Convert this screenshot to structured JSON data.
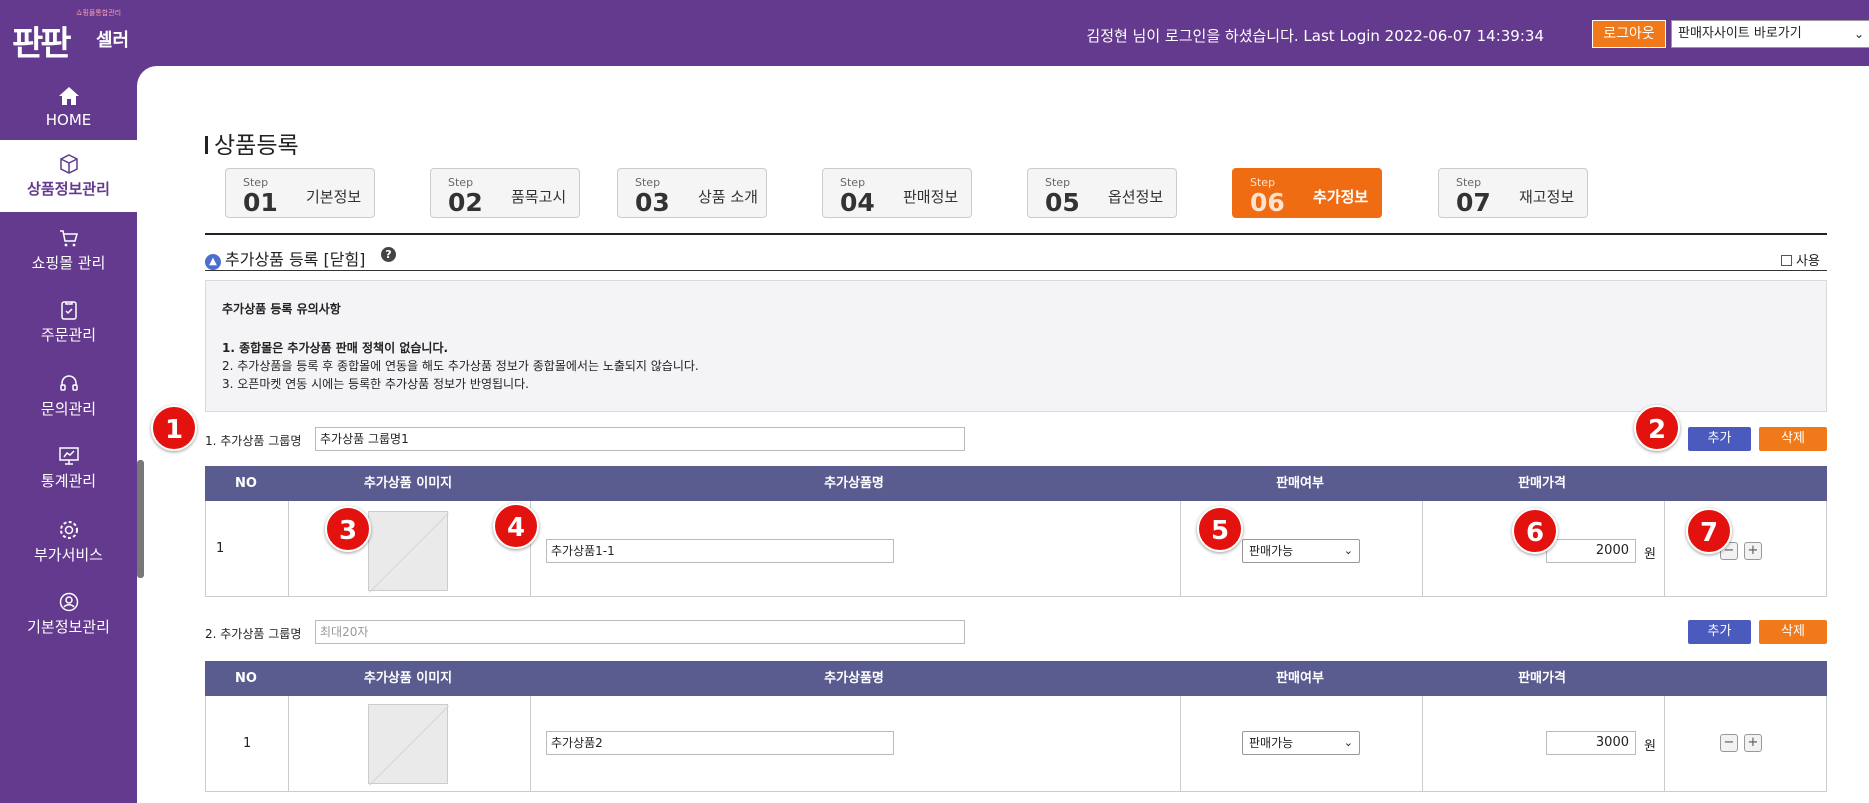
{
  "header": {
    "logo_sub": "쇼핑몰통합관리",
    "logo_main": "판판",
    "logo_seller": "셀러",
    "login_info": "김정현  님이 로그인을 하셨습니다. Last Login 2022-06-07 14:39:34",
    "logout_label": "로그아웃",
    "site_select_value": "판매자사이트 바로가기",
    "brand_color": "#643a8e",
    "accent_color": "#f07a1a"
  },
  "sidebar": {
    "items": [
      {
        "label": "HOME",
        "icon": "home-icon"
      },
      {
        "label": "상품정보관리",
        "icon": "box-icon"
      },
      {
        "label": "쇼핑몰 관리",
        "icon": "cart-icon"
      },
      {
        "label": "주문관리",
        "icon": "clipboard-icon"
      },
      {
        "label": "문의관리",
        "icon": "headset-icon"
      },
      {
        "label": "통계관리",
        "icon": "chart-board-icon"
      },
      {
        "label": "부가서비스",
        "icon": "gear-icon"
      },
      {
        "label": "기본정보관리",
        "icon": "user-circle-icon"
      }
    ],
    "active": "상품정보관리"
  },
  "page": {
    "title": "상품등록"
  },
  "steps": [
    {
      "label": "Step",
      "num": "01",
      "name": "기본정보"
    },
    {
      "label": "Step",
      "num": "02",
      "name": "품목고시"
    },
    {
      "label": "Step",
      "num": "03",
      "name": "상품 소개"
    },
    {
      "label": "Step",
      "num": "04",
      "name": "판매정보"
    },
    {
      "label": "Step",
      "num": "05",
      "name": "옵션정보"
    },
    {
      "label": "Step",
      "num": "06",
      "name": "추가정보"
    },
    {
      "label": "Step",
      "num": "07",
      "name": "재고정보"
    }
  ],
  "active_step": "06",
  "section": {
    "title": "추가상품 등록 [닫힘]",
    "help": "?",
    "use_label": "사용"
  },
  "notice": {
    "title": "추가상품 등록 유의사항",
    "lines": [
      "1. 종합몰은 추가상품 판매 정책이 없습니다.",
      "2. 추가상품을 등록 후 종합몰에 연동을 해도 추가상품 정보가 종합몰에서는 노출되지 않습니다.",
      "3. 오픈마켓 연동 시에는 등록한 추가상품 정보가 반영됩니다."
    ]
  },
  "table_headers": [
    "NO",
    "추가상품 이미지",
    "추가상품명",
    "판매여부",
    "판매가격"
  ],
  "groups": [
    {
      "label": "1. 추가상품 그룹명",
      "value": "추가상품 그룹명1",
      "placeholder": "",
      "add_label": "추가",
      "delete_label": "삭제",
      "rows": [
        {
          "no": "1",
          "name": "추가상품1-1",
          "sale": "판매가능",
          "price": "2000",
          "unit": "원"
        }
      ]
    },
    {
      "label": "2. 추가상품 그룹명",
      "value": "최대20자",
      "placeholder": "최대20자",
      "add_label": "추가",
      "delete_label": "삭제",
      "rows": [
        {
          "no": "1",
          "name": "추가상품2",
          "sale": "판매가능",
          "price": "3000",
          "unit": "원"
        }
      ]
    }
  ],
  "row_buttons": {
    "minus": "−",
    "plus": "+"
  },
  "markers": [
    "1",
    "2",
    "3",
    "4",
    "5",
    "6",
    "7"
  ]
}
